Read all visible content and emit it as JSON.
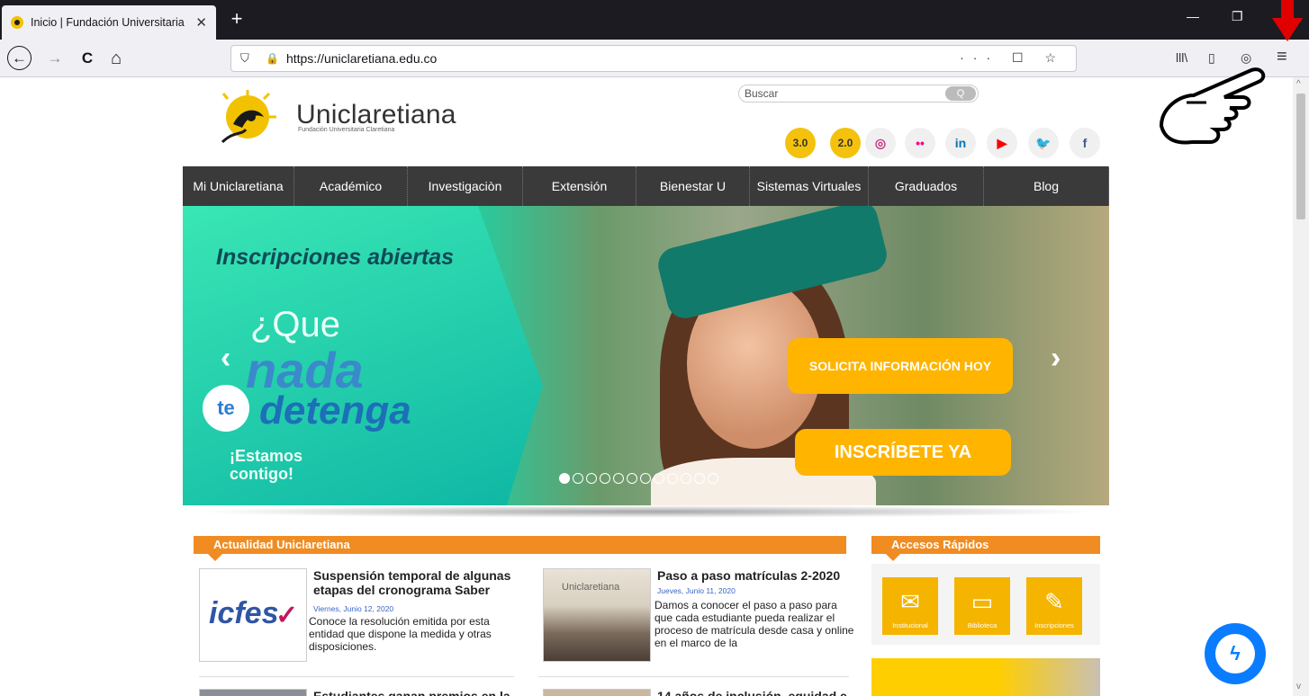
{
  "browser": {
    "tab_title": "Inicio | Fundación Universitaria",
    "tab_close": "✕",
    "new_tab": "+",
    "minimize": "—",
    "restore": "❐",
    "back": "←",
    "forward": "→",
    "reload": "C",
    "home": "⌂",
    "url": "https://uniclaretiana.edu.co",
    "url_actions": "··· ☐ ☆",
    "library_icon": "lll\\",
    "sidebar_icon": "▯",
    "tracking_icon": "◎",
    "menu_icon": "≡"
  },
  "site": {
    "logo_name": "Uniclaretiana",
    "logo_sub": "Fundación Universitaria Claretiana",
    "search_placeholder": "Buscar",
    "search_btn": "Q",
    "social": [
      {
        "name": "av30",
        "label": "3.0",
        "color": "#f4c20d"
      },
      {
        "name": "av20",
        "label": "2.0",
        "color": "#f4c20d"
      },
      {
        "name": "instagram",
        "label": "◎",
        "color": "#c13584"
      },
      {
        "name": "flickr",
        "label": "••",
        "color": "#ff0084"
      },
      {
        "name": "linkedin",
        "label": "in",
        "color": "#0077b5"
      },
      {
        "name": "youtube",
        "label": "▶",
        "color": "#ff0000"
      },
      {
        "name": "twitter",
        "label": "🐦",
        "color": "#1da1f2"
      },
      {
        "name": "facebook",
        "label": "f",
        "color": "#3b5998"
      }
    ],
    "menu": [
      "Mi Uniclaretiana",
      "Académico",
      "Investigaciòn",
      "Extensión",
      "Bienestar U",
      "Sistemas Virtuales",
      "Graduados",
      "Blog"
    ]
  },
  "slider": {
    "tag": "Inscripciones abiertas",
    "line1": "¿Que",
    "line2": "nada",
    "line3_te": "te",
    "line3": "detenga",
    "line4": "¡Estamos contigo!",
    "cta1": "SOLICITA INFORMACIÓN HOY",
    "cta2": "INSCRÍBETE YA",
    "prev": "‹",
    "next": "›",
    "slide_count": 12,
    "active_slide": 0
  },
  "sections": {
    "news_head": "Actualidad Uniclaretiana",
    "quick_head": "Accesos Rápidos"
  },
  "news": [
    {
      "title": "Suspensión temporal de algunas etapas del cronograma Saber",
      "date": "Viernes, Junio 12, 2020",
      "text": "Conoce la resolución emitida por esta entidad que dispone la medida y otras disposiciones.",
      "img_label": "icfes"
    },
    {
      "title": "Paso a paso matrículas 2-2020",
      "date": "Jueves, Junio 11, 2020",
      "text": "Damos a conocer el paso a paso para que cada estudiante pueda realizar el proceso de matrícula desde casa y online en el marco de la",
      "img_label": "Uniclaretiana"
    },
    {
      "title": "Estudiantes ganan premios en la",
      "date": "",
      "text": "",
      "img_label": ""
    },
    {
      "title": "14 años de inclusión, equidad e",
      "date": "",
      "text": "",
      "img_label": ""
    }
  ],
  "quick": [
    {
      "label": "Institucional",
      "icon": "✉"
    },
    {
      "label": "Biblioteca",
      "icon": "▭"
    },
    {
      "label": "Inscripciones",
      "icon": "✎"
    }
  ],
  "messenger_icon": "ϟ"
}
